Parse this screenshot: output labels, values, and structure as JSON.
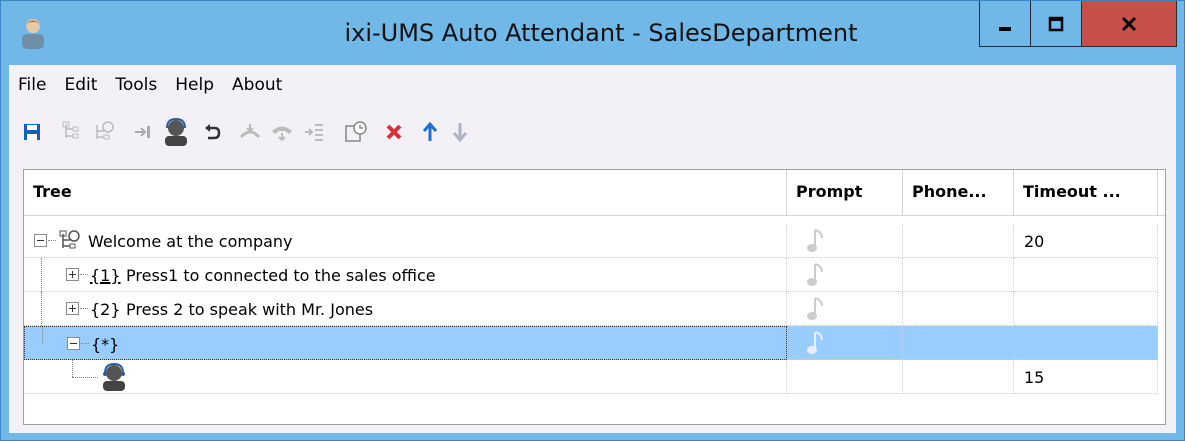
{
  "window": {
    "title": "ixi-UMS Auto Attendant - SalesDepartment",
    "colors": {
      "titlebar": "#70b8e8",
      "close": "#c7504a",
      "selection": "#99ccff"
    }
  },
  "menu": [
    "File",
    "Edit",
    "Tools",
    "Help",
    "About"
  ],
  "toolbar": {
    "icons": [
      "save-icon",
      "tree-node-icon",
      "tree-welcome-icon",
      "transfer-icon",
      "agent-icon",
      "back-icon",
      "hangup-icon",
      "phone-icon",
      "queue-icon",
      "schedule-icon",
      "delete-icon",
      "move-up-icon",
      "move-down-icon"
    ]
  },
  "grid": {
    "columns": [
      "Tree",
      "Prompt",
      "Phone...",
      "Timeout ..."
    ],
    "rows": [
      {
        "label": "Welcome at the company",
        "timeout": "20",
        "prompt_icon": "music-note-icon"
      },
      {
        "key": "{1}",
        "label": "Press1 to connected to the sales office",
        "timeout": "",
        "prompt_icon": "music-note-icon"
      },
      {
        "key": "{2}",
        "label": "Press 2 to speak with Mr. Jones",
        "timeout": "",
        "prompt_icon": "music-note-icon"
      },
      {
        "key": "{*}",
        "label": "",
        "timeout": "",
        "prompt_icon": "music-note-icon",
        "selected": true
      },
      {
        "label": "",
        "timeout": "15",
        "icon": "agent-icon"
      }
    ]
  }
}
